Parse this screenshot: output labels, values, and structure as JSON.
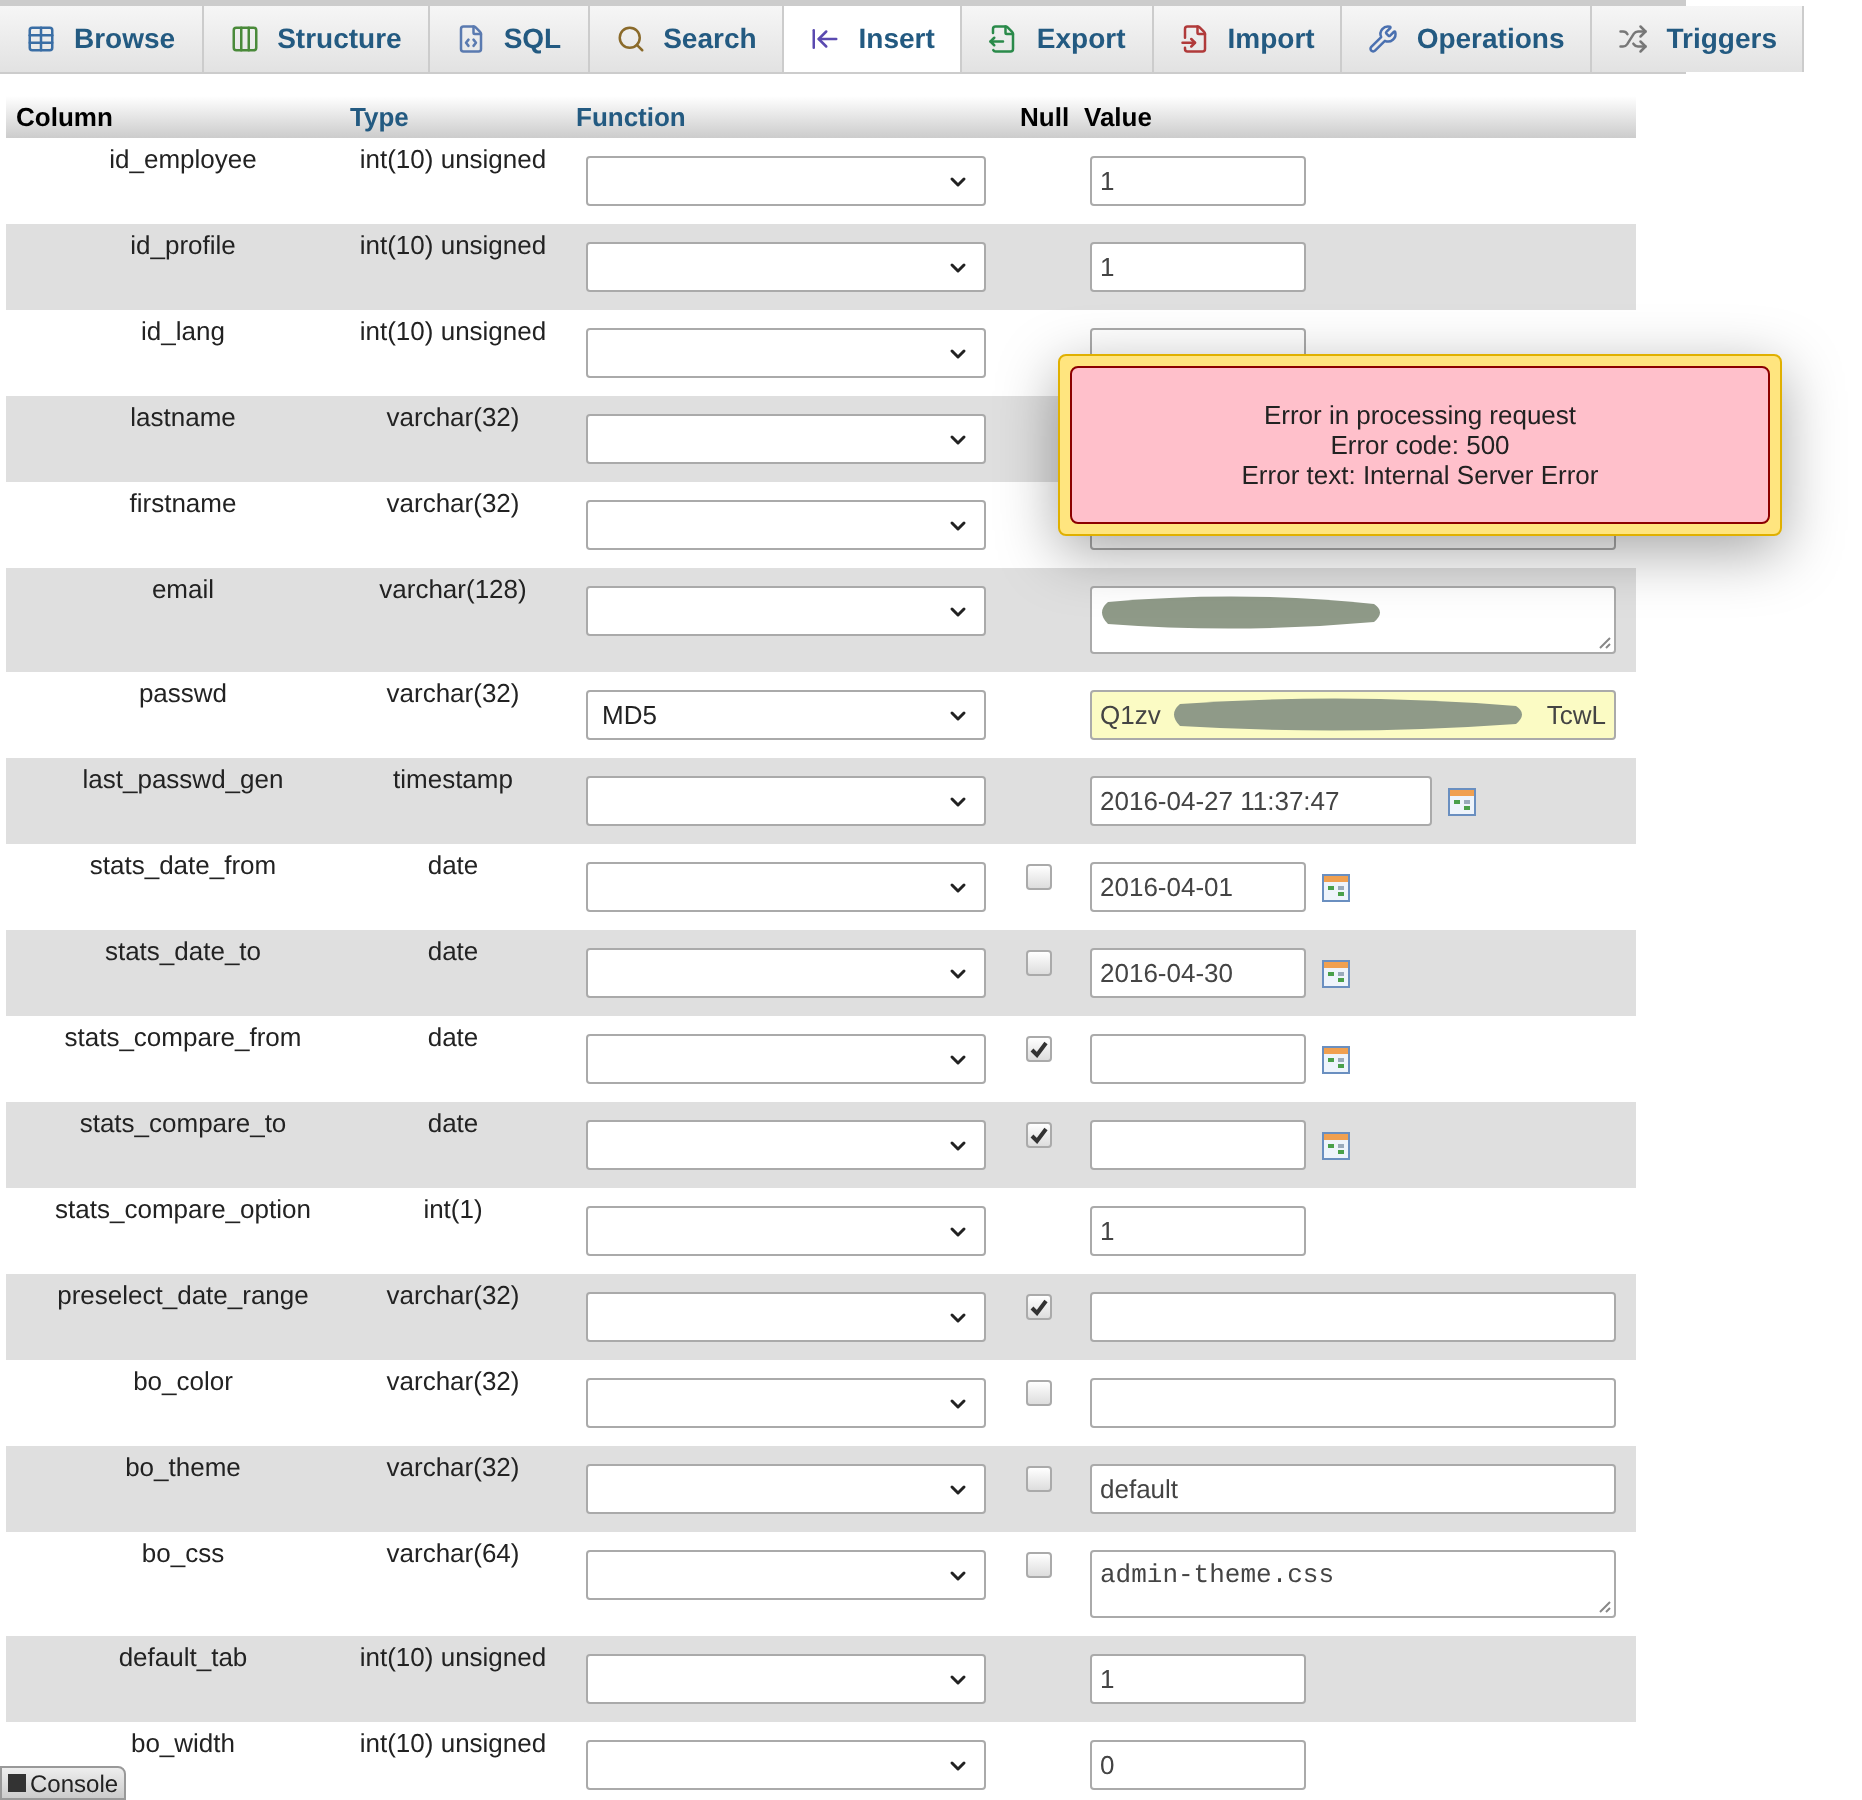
{
  "tabs": [
    {
      "label": "Browse",
      "selected": false
    },
    {
      "label": "Structure",
      "selected": false
    },
    {
      "label": "SQL",
      "selected": false
    },
    {
      "label": "Search",
      "selected": false
    },
    {
      "label": "Insert",
      "selected": true
    },
    {
      "label": "Export",
      "selected": false
    },
    {
      "label": "Import",
      "selected": false
    },
    {
      "label": "Operations",
      "selected": false
    },
    {
      "label": "Triggers",
      "selected": false
    }
  ],
  "table": {
    "columns": [
      {
        "label": "Column",
        "sortable": false
      },
      {
        "label": "Type",
        "sortable": true
      },
      {
        "label": "Function",
        "sortable": true
      },
      {
        "label": "Null",
        "sortable": false
      },
      {
        "label": "Value",
        "sortable": false
      }
    ],
    "rows": [
      {
        "column": "id_employee",
        "type": "int(10) unsigned",
        "kind": "short",
        "value": "1"
      },
      {
        "column": "id_profile",
        "type": "int(10) unsigned",
        "kind": "short",
        "value": "1"
      },
      {
        "column": "id_lang",
        "type": "int(10) unsigned",
        "kind": "short"
      },
      {
        "column": "lastname",
        "type": "varchar(32)"
      },
      {
        "column": "firstname",
        "type": "varchar(32)",
        "kind": "wide"
      },
      {
        "column": "email",
        "type": "varchar(128)",
        "kind": "textarea",
        "redacted": true
      },
      {
        "column": "passwd",
        "type": "varchar(32)",
        "function": "MD5",
        "kind": "password",
        "autofill": true,
        "redacted": true,
        "value": "Q1zv",
        "value_end": "TcwL"
      },
      {
        "column": "last_passwd_gen",
        "type": "timestamp",
        "kind": "datetime",
        "value": "2016-04-27 11:37:47"
      },
      {
        "column": "stats_date_from",
        "type": "date",
        "null": false,
        "kind": "date",
        "value": "2016-04-01"
      },
      {
        "column": "stats_date_to",
        "type": "date",
        "null": false,
        "kind": "date",
        "value": "2016-04-30"
      },
      {
        "column": "stats_compare_from",
        "type": "date",
        "null": true,
        "kind": "date"
      },
      {
        "column": "stats_compare_to",
        "type": "date",
        "null": true,
        "kind": "date"
      },
      {
        "column": "stats_compare_option",
        "type": "int(1)",
        "kind": "short",
        "value": "1"
      },
      {
        "column": "preselect_date_range",
        "type": "varchar(32)",
        "null": true,
        "kind": "wide"
      },
      {
        "column": "bo_color",
        "type": "varchar(32)",
        "null": false,
        "kind": "wide"
      },
      {
        "column": "bo_theme",
        "type": "varchar(32)",
        "null": false,
        "kind": "wide",
        "value": "default"
      },
      {
        "column": "bo_css",
        "type": "varchar(64)",
        "null": false,
        "kind": "textarea",
        "value": "admin-theme.css"
      },
      {
        "column": "default_tab",
        "type": "int(10) unsigned",
        "kind": "short",
        "value": "1"
      },
      {
        "column": "bo_width",
        "type": "int(10) unsigned",
        "kind": "short",
        "value": "0"
      }
    ]
  },
  "error_dialog": {
    "lines": [
      "Error in processing request",
      "Error code: 500",
      "Error text: Internal Server Error"
    ]
  },
  "console": {
    "label": "Console"
  }
}
